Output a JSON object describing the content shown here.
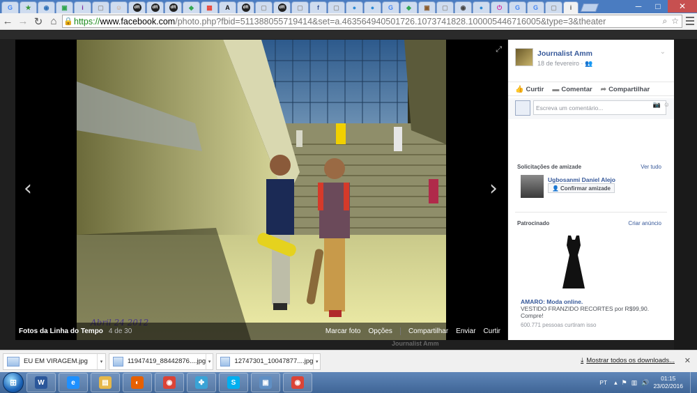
{
  "browser": {
    "tabs": [
      {
        "glyph": "G",
        "color": "#4285f4"
      },
      {
        "glyph": "★",
        "color": "#3b9a3b"
      },
      {
        "glyph": "◉",
        "color": "#2d6fb7"
      },
      {
        "glyph": "▣",
        "color": "#2ea44f"
      },
      {
        "glyph": "i",
        "color": "#7b2aa0"
      },
      {
        "glyph": "▢",
        "color": "#999999"
      },
      {
        "glyph": "☺",
        "color": "#d19a6a"
      },
      {
        "glyph": "dft",
        "color": "#222222"
      },
      {
        "glyph": "dft",
        "color": "#222222"
      },
      {
        "glyph": "dft",
        "color": "#222222"
      },
      {
        "glyph": "◆",
        "color": "#34a853"
      },
      {
        "glyph": "▦",
        "color": "#ea4335"
      },
      {
        "glyph": "A",
        "color": "#111111"
      },
      {
        "glyph": "dft",
        "color": "#222222"
      },
      {
        "glyph": "▢",
        "color": "#999999"
      },
      {
        "glyph": "dft",
        "color": "#222222"
      },
      {
        "glyph": "▢",
        "color": "#999999"
      },
      {
        "glyph": "f",
        "color": "#3b5998"
      },
      {
        "glyph": "▢",
        "color": "#999999"
      },
      {
        "glyph": "●",
        "color": "#2b8ad6"
      },
      {
        "glyph": "●",
        "color": "#2b8ad6"
      },
      {
        "glyph": "G",
        "color": "#4285f4"
      },
      {
        "glyph": "◆",
        "color": "#34a853"
      },
      {
        "glyph": "▣",
        "color": "#8a5a2a"
      },
      {
        "glyph": "▢",
        "color": "#999999"
      },
      {
        "glyph": "◉",
        "color": "#444444"
      },
      {
        "glyph": "●",
        "color": "#2b8ad6"
      },
      {
        "glyph": "⏻",
        "color": "#d6249f"
      },
      {
        "glyph": "G",
        "color": "#4285f4"
      },
      {
        "glyph": "G",
        "color": "#4285f4"
      },
      {
        "glyph": "▢",
        "color": "#999999"
      },
      {
        "glyph": "i",
        "color": "#555555"
      }
    ],
    "window_controls": {
      "minimize": "─",
      "maximize": "□",
      "close": "✕"
    },
    "url_scheme": "https://",
    "url_host": "www.facebook.com",
    "url_rest": "/photo.php?fbid=511388055719414&set=a.463564940501726.1073741828.100005446716005&type=3&theater"
  },
  "viewer": {
    "album_title": "Fotos da Linha do Tempo",
    "position": "4 de 30",
    "photo_caption": "Abril 24 2012",
    "actions": [
      "Marcar foto",
      "Opções",
      "Compartilhar",
      "Enviar",
      "Curtir"
    ],
    "prev_arrow": "‹",
    "next_arrow": "›",
    "expand_icon": "⤢"
  },
  "post": {
    "author": "Journalist Amm",
    "date": "18 de fevereiro",
    "audience_icon": "friends-icon",
    "actions": [
      {
        "icon": "like-icon",
        "glyph": "👍",
        "label": "Curtir"
      },
      {
        "icon": "comment-icon",
        "glyph": "▬",
        "label": "Comentar"
      },
      {
        "icon": "share-icon",
        "glyph": "➦",
        "label": "Compartilhar"
      }
    ],
    "comment_placeholder": "Escreva um comentário..."
  },
  "friend_requests": {
    "title": "Solicitações de amizade",
    "see_all": "Ver tudo",
    "person": "Ugbosanmi Daniel Alejo",
    "confirm_label": "Confirmar amizade"
  },
  "sponsored": {
    "title": "Patrocinado",
    "create_ad": "Criar anúncio",
    "ad_title": "AMARO: Moda online.",
    "ad_text": "VESTIDO FRANZIDO RECORTES por R$99,90. Compre!",
    "ad_likes": "600.771 pessoas curtiram isso"
  },
  "background_page": {
    "author_label": "Journalist Amm"
  },
  "downloads": {
    "items": [
      {
        "name": "EU EM VIRAGEM.jpg"
      },
      {
        "name": "11947419_88442876....jpg"
      },
      {
        "name": "12747301_10047877....jpg"
      }
    ],
    "show_all": "Mostrar todos os downloads...",
    "close": "✕"
  },
  "taskbar": {
    "apps": [
      {
        "name": "word",
        "glyph": "W",
        "color": "#2b579a"
      },
      {
        "name": "internet-explorer",
        "glyph": "e",
        "color": "#1e90ff"
      },
      {
        "name": "file-explorer",
        "glyph": "▤",
        "color": "#e6b84a"
      },
      {
        "name": "firefox",
        "glyph": "◐",
        "color": "#e66000"
      },
      {
        "name": "chrome",
        "glyph": "◉",
        "color": "#db4437"
      },
      {
        "name": "network",
        "glyph": "✤",
        "color": "#3aa3d6"
      },
      {
        "name": "skype",
        "glyph": "S",
        "color": "#00aff0"
      },
      {
        "name": "photo-viewer",
        "glyph": "▣",
        "color": "#5f8fc4"
      },
      {
        "name": "chrome",
        "glyph": "◉",
        "color": "#db4437"
      }
    ],
    "language": "PT",
    "time": "01:15",
    "date": "23/02/2016"
  }
}
